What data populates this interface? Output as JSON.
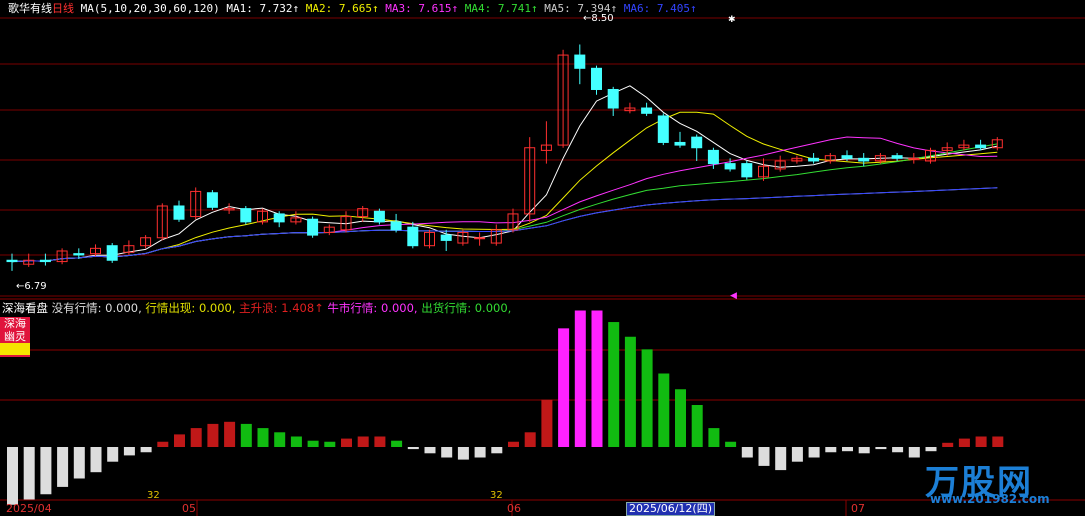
{
  "header": {
    "stock_name": "歌华有线",
    "period": "日线",
    "ma_params": "MA(5,10,20,30,60,120)",
    "ma_values": [
      {
        "label": "MA1:",
        "value": "7.732↑",
        "color": "#ffffff"
      },
      {
        "label": "MA2:",
        "value": "7.665↑",
        "color": "#f0f000"
      },
      {
        "label": "MA3:",
        "value": "7.615↑",
        "color": "#ff33ff"
      },
      {
        "label": "MA4:",
        "value": "7.741↑",
        "color": "#33dd33"
      },
      {
        "label": "MA5:",
        "value": "7.394↑",
        "color": "#cccccc"
      },
      {
        "label": "MA6:",
        "value": "7.405↑",
        "color": "#3344ff"
      }
    ]
  },
  "price_labels": {
    "high": "8.50",
    "low": "6.79"
  },
  "indicator": {
    "name": "深海看盘",
    "items": [
      {
        "label": "没有行情:",
        "value": "0.000,",
        "color": "#dddddd"
      },
      {
        "label": "行情出现:",
        "value": "0.000,",
        "color": "#e0e000"
      },
      {
        "label": "主升浪:",
        "value": "1.408↑",
        "color": "#e02020"
      },
      {
        "label": "牛市行情:",
        "value": "0.000,",
        "color": "#ff33ff"
      },
      {
        "label": "出货行情:",
        "value": "0.000,",
        "color": "#33dd33"
      }
    ],
    "box_line1": "深海",
    "box_line2": "幽灵"
  },
  "axis": {
    "months": [
      "2025/04",
      "05",
      "06",
      "07"
    ],
    "current_date": "2025/06/12(四)",
    "markers": [
      "32",
      "32"
    ]
  },
  "watermark": {
    "brand": "万股网",
    "url": "www.201982.com"
  },
  "colors": {
    "up": "#ff3030",
    "down": "#44ffff",
    "bg": "#000000",
    "grid": "#800000"
  },
  "chart_data": {
    "type": "candlestick",
    "candles": [
      [
        6.87,
        6.86,
        6.92,
        6.79
      ],
      [
        6.84,
        6.87,
        6.92,
        6.82
      ],
      [
        6.87,
        6.86,
        6.92,
        6.83
      ],
      [
        6.86,
        6.94,
        6.96,
        6.84
      ],
      [
        6.92,
        6.91,
        6.96,
        6.88
      ],
      [
        6.92,
        6.96,
        6.99,
        6.9
      ],
      [
        6.98,
        6.87,
        7.0,
        6.85
      ],
      [
        6.93,
        6.98,
        7.02,
        6.91
      ],
      [
        6.98,
        7.04,
        7.06,
        6.96
      ],
      [
        7.04,
        7.28,
        7.3,
        7.02
      ],
      [
        7.28,
        7.18,
        7.32,
        7.16
      ],
      [
        7.2,
        7.39,
        7.42,
        7.18
      ],
      [
        7.38,
        7.27,
        7.4,
        7.25
      ],
      [
        7.25,
        7.26,
        7.3,
        7.22
      ],
      [
        7.26,
        7.16,
        7.28,
        7.14
      ],
      [
        7.16,
        7.24,
        7.26,
        7.14
      ],
      [
        7.22,
        7.16,
        7.24,
        7.12
      ],
      [
        7.16,
        7.19,
        7.24,
        7.14
      ],
      [
        7.18,
        7.06,
        7.2,
        7.04
      ],
      [
        7.08,
        7.12,
        7.14,
        7.06
      ],
      [
        7.1,
        7.2,
        7.24,
        7.08
      ],
      [
        7.2,
        7.26,
        7.28,
        7.16
      ],
      [
        7.24,
        7.16,
        7.26,
        7.14
      ],
      [
        7.16,
        7.1,
        7.22,
        7.08
      ],
      [
        7.12,
        6.98,
        7.16,
        6.96
      ],
      [
        6.98,
        7.08,
        7.1,
        6.96
      ],
      [
        7.06,
        7.02,
        7.1,
        6.94
      ],
      [
        7.0,
        7.08,
        7.1,
        6.98
      ],
      [
        7.04,
        7.04,
        7.08,
        6.98
      ],
      [
        7.0,
        7.1,
        7.14,
        6.98
      ],
      [
        7.1,
        7.22,
        7.26,
        7.08
      ],
      [
        7.22,
        7.72,
        7.8,
        7.16
      ],
      [
        7.7,
        7.74,
        7.92,
        7.6
      ],
      [
        7.74,
        8.42,
        8.46,
        7.72
      ],
      [
        8.42,
        8.32,
        8.5,
        8.2
      ],
      [
        8.32,
        8.16,
        8.34,
        8.12
      ],
      [
        8.16,
        8.02,
        8.18,
        7.96
      ],
      [
        8.0,
        8.02,
        8.06,
        7.98
      ],
      [
        8.02,
        7.98,
        8.06,
        7.96
      ],
      [
        7.96,
        7.76,
        7.98,
        7.74
      ],
      [
        7.76,
        7.74,
        7.84,
        7.72
      ],
      [
        7.8,
        7.72,
        7.82,
        7.62
      ],
      [
        7.7,
        7.6,
        7.72,
        7.56
      ],
      [
        7.6,
        7.56,
        7.64,
        7.54
      ],
      [
        7.6,
        7.5,
        7.62,
        7.48
      ],
      [
        7.5,
        7.58,
        7.64,
        7.47
      ],
      [
        7.56,
        7.62,
        7.66,
        7.54
      ],
      [
        7.62,
        7.64,
        7.66,
        7.6
      ],
      [
        7.64,
        7.62,
        7.68,
        7.6
      ],
      [
        7.62,
        7.66,
        7.68,
        7.6
      ],
      [
        7.66,
        7.64,
        7.7,
        7.62
      ],
      [
        7.64,
        7.62,
        7.68,
        7.58
      ],
      [
        7.62,
        7.66,
        7.68,
        7.6
      ],
      [
        7.66,
        7.64,
        7.68,
        7.62
      ],
      [
        7.64,
        7.64,
        7.68,
        7.6
      ],
      [
        7.62,
        7.7,
        7.72,
        7.6
      ],
      [
        7.7,
        7.72,
        7.76,
        7.66
      ],
      [
        7.72,
        7.74,
        7.78,
        7.7
      ],
      [
        7.74,
        7.72,
        7.78,
        7.7
      ],
      [
        7.72,
        7.78,
        7.8,
        7.7
      ]
    ],
    "indicator_bars": [
      -0.55,
      -0.5,
      -0.45,
      -0.38,
      -0.3,
      -0.24,
      -0.14,
      -0.08,
      -0.05,
      0.05,
      0.12,
      0.18,
      0.22,
      0.24,
      0.22,
      0.18,
      0.14,
      0.1,
      0.06,
      0.05,
      0.08,
      0.1,
      0.1,
      0.06,
      -0.02,
      -0.06,
      -0.1,
      -0.12,
      -0.1,
      -0.06,
      0.05,
      0.14,
      0.45,
      1.13,
      1.3,
      1.3,
      1.19,
      1.05,
      0.93,
      0.7,
      0.55,
      0.4,
      0.18,
      0.05,
      -0.1,
      -0.18,
      -0.22,
      -0.14,
      -0.1,
      -0.05,
      -0.04,
      -0.06,
      -0.02,
      -0.05,
      -0.1,
      -0.04,
      0.04,
      0.08,
      0.1,
      0.1
    ],
    "indicator_colors": "white-neg,red-up,green-down,magenta-peak",
    "ylim": [
      6.6,
      8.7
    ]
  }
}
